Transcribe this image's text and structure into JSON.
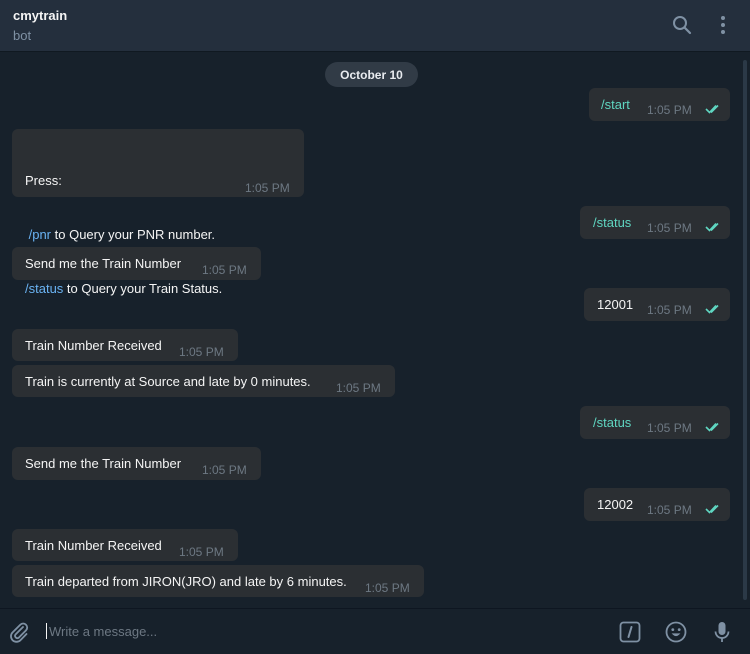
{
  "header": {
    "title": "cmytrain",
    "subtitle": "bot",
    "search_icon": "search-icon",
    "menu_icon": "more-vertical-icon"
  },
  "date_pill": "October 10",
  "messages": [
    {
      "direction": "out",
      "text": "/start",
      "time": "1:05 PM",
      "status": "read"
    },
    {
      "direction": "in",
      "lines": [
        {
          "parts": [
            {
              "text": "Press:",
              "kind": "plain"
            }
          ]
        },
        {
          "parts": [
            {
              "text": " /pnr",
              "kind": "command"
            },
            {
              "text": " to Query your PNR number.",
              "kind": "plain"
            }
          ]
        },
        {
          "parts": [
            {
              "text": "/status",
              "kind": "command"
            },
            {
              "text": " to Query your Train Status.",
              "kind": "plain"
            }
          ]
        }
      ],
      "time": "1:05 PM"
    },
    {
      "direction": "out",
      "text": "/status",
      "time": "1:05 PM",
      "status": "read"
    },
    {
      "direction": "in",
      "text": "Send me the Train Number",
      "time": "1:05 PM"
    },
    {
      "direction": "out",
      "text": "12001",
      "time": "1:05 PM",
      "status": "read"
    },
    {
      "direction": "in",
      "text": "Train Number Received",
      "time": "1:05 PM"
    },
    {
      "direction": "in",
      "text": "Train is currently at Source and late by 0 minutes.",
      "time": "1:05 PM"
    },
    {
      "direction": "out",
      "text": "/status",
      "time": "1:05 PM",
      "status": "read"
    },
    {
      "direction": "in",
      "text": "Send me the Train Number",
      "time": "1:05 PM"
    },
    {
      "direction": "out",
      "text": "12002",
      "time": "1:05 PM",
      "status": "read"
    },
    {
      "direction": "in",
      "text": "Train Number Received",
      "time": "1:05 PM"
    },
    {
      "direction": "in",
      "text": "Train departed from JIRON(JRO) and late by 6 minutes.",
      "time": "1:05 PM"
    }
  ],
  "composer": {
    "placeholder": "Write a message...",
    "attach_icon": "paperclip-icon",
    "commands_icon": "slash-commands-icon",
    "emoji_icon": "smile-icon",
    "mic_icon": "microphone-icon"
  },
  "colors": {
    "background": "#17212b",
    "header": "#242f3d",
    "bubble": "#2b2f33",
    "command_link": "#6ab3f3",
    "outgoing_text": "#5fd6c1",
    "read_ticks": "#5fd6c1",
    "muted": "#6d7883"
  }
}
